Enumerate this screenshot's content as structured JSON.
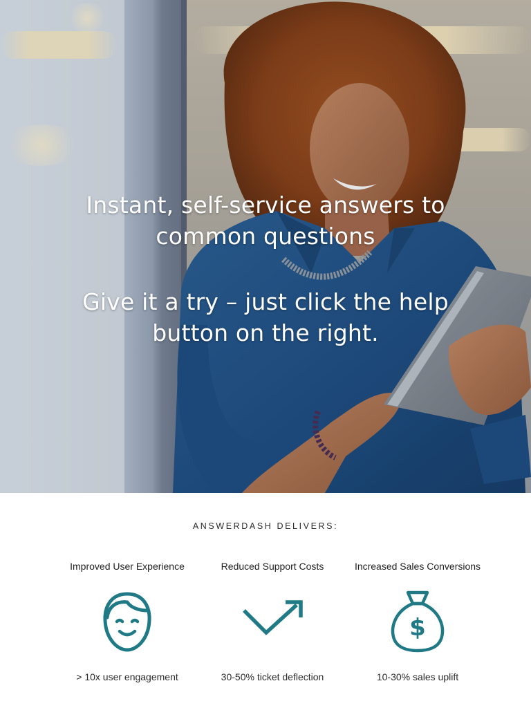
{
  "hero": {
    "line1": "Instant, self-service answers to common questions",
    "line2": "Give it a try – just click the help button on the right.",
    "image": "smiling-woman-with-tablet-photo"
  },
  "features_section": {
    "title": "ANSWERDASH DELIVERS:",
    "accent_color": "#1f7a86",
    "items": [
      {
        "title": "Improved User Experience",
        "icon": "smiling-face-icon",
        "stat": "> 10x user engagement"
      },
      {
        "title": "Reduced Support Costs",
        "icon": "down-up-arrow-icon",
        "stat": "30-50% ticket deflection"
      },
      {
        "title": "Increased Sales Conversions",
        "icon": "money-bag-icon",
        "stat": "10-30% sales uplift"
      }
    ]
  }
}
